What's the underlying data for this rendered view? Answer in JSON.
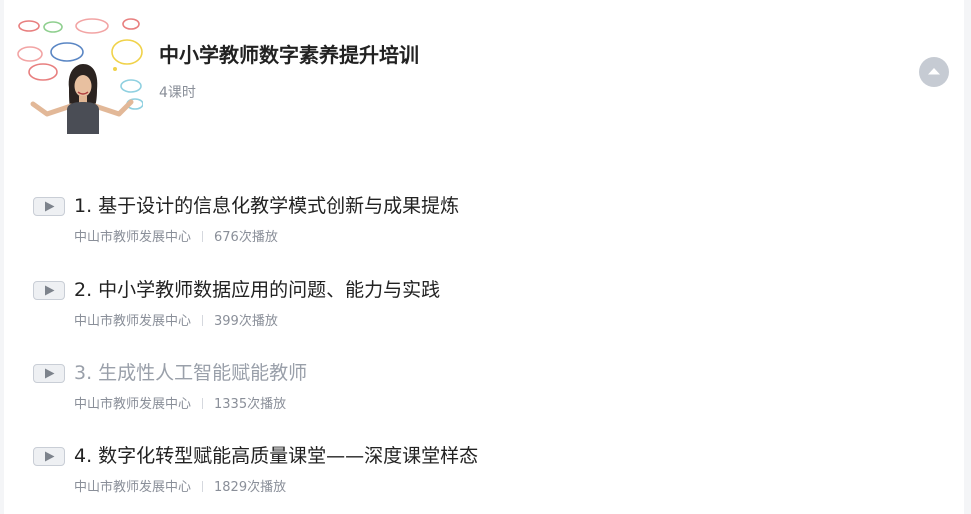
{
  "course": {
    "title": "中小学教师数字素养提升培训",
    "lesson_count": "4课时"
  },
  "lessons": [
    {
      "title": "1. 基于设计的信息化教学模式创新与成果提炼",
      "org": "中山市教师发展中心",
      "plays": "676次播放",
      "watched": false
    },
    {
      "title": "2. 中小学教师数据应用的问题、能力与实践",
      "org": "中山市教师发展中心",
      "plays": "399次播放",
      "watched": false
    },
    {
      "title": "3. 生成性人工智能赋能教师",
      "org": "中山市教师发展中心",
      "plays": "1335次播放",
      "watched": true
    },
    {
      "title": "4. 数字化转型赋能高质量课堂——深度课堂样态",
      "org": "中山市教师发展中心",
      "plays": "1829次播放",
      "watched": false
    }
  ],
  "icons": {
    "collapse": "chevron-up-icon",
    "play": "play-icon"
  },
  "colors": {
    "title": "#222222",
    "muted": "#8a8f99",
    "watched": "#9aa0aa",
    "collapse_bg": "#c6cbd3"
  }
}
